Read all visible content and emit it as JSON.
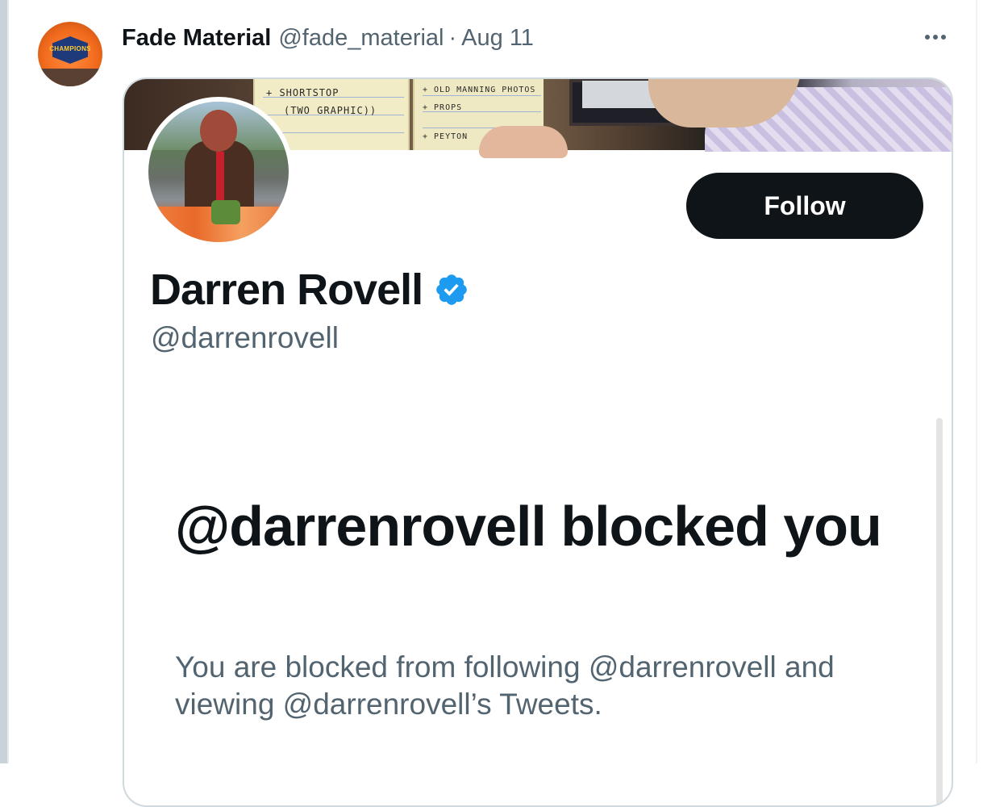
{
  "tweet": {
    "author_name": "Fade Material",
    "author_handle": "@fade_material",
    "separator": "·",
    "date": "Aug 11",
    "more_icon": "more-horizontal-icon",
    "avatar_badge_text": "CHAMPIONS"
  },
  "embedded_profile": {
    "name": "Darren Rovell",
    "verified": true,
    "verified_color": "#1d9bf0",
    "handle": "@darrenrovell",
    "follow_label": "Follow",
    "banner_notes": {
      "left_line1": "+ SHORTSTOP",
      "left_line2": "(TWO GRAPHIC))",
      "right_line1": "+ OLD MANNING PHOTOS",
      "right_line2": "+ PROPS",
      "right_line3": "+ PEYTON"
    }
  },
  "blocked_notice": {
    "title": "@darrenrovell blocked you",
    "description": "You are blocked from following @darrenrovell and viewing @darrenrovell’s Tweets."
  },
  "colors": {
    "text_primary": "#0f1419",
    "text_secondary": "#536471",
    "border": "#cfd9de",
    "button_bg": "#0f1419"
  }
}
